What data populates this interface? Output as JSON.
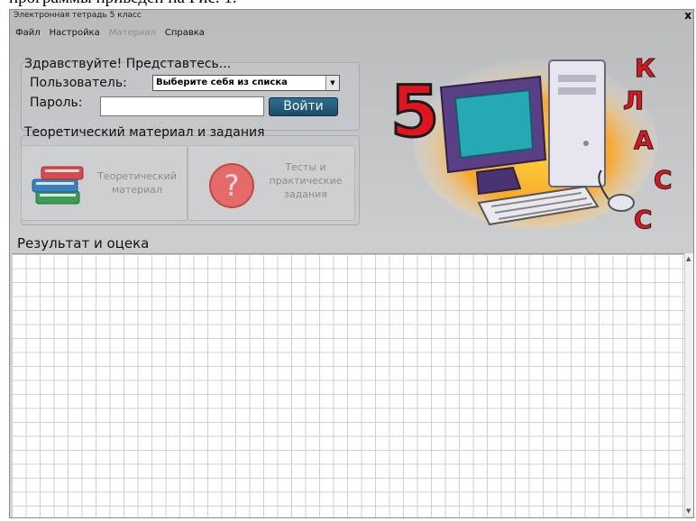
{
  "doc_caption": "программы приведен на Рис. 1.",
  "window": {
    "title": "Электронная тетрадь 5 класс",
    "close_label": "x"
  },
  "menu": {
    "file": "Файл",
    "settings": "Настройка",
    "material": "Материал",
    "help": "Справка"
  },
  "login": {
    "greeting": "Здравствуйте! Представтесь...",
    "user_label": "Пользователь:",
    "user_selected": "Выберите себя из списка",
    "password_label": "Пароль:",
    "password_value": "",
    "login_button": "Войти"
  },
  "theory": {
    "section_title": "Теоретический материал и задания",
    "tile1_line1": "Теоретический",
    "tile1_line2": "материал",
    "tile2_line1": "Тесты и",
    "tile2_line2": "практические",
    "tile2_line3": "задания"
  },
  "results": {
    "title": "Результат и оцека"
  },
  "banner": {
    "number": "5",
    "letters": [
      "К",
      "Л",
      "А",
      "С",
      "С"
    ]
  },
  "colors": {
    "accent_red": "#e0141c",
    "button_blue": "#245d7e",
    "screen_teal": "#27a9b3",
    "computer_purple": "#5a3f86"
  }
}
